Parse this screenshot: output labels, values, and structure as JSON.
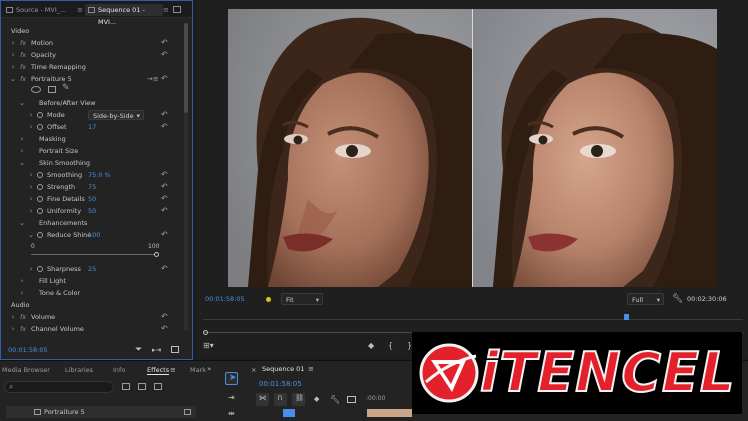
{
  "effect_controls": {
    "tabs": [
      {
        "label": "Source - MVI_..."
      },
      {
        "label": "Sequence 01 - MVI..."
      }
    ],
    "rows": [
      {
        "type": "section",
        "label": "Video"
      },
      {
        "type": "fx",
        "label": "Motion"
      },
      {
        "type": "fx",
        "label": "Opacity"
      },
      {
        "type": "fx",
        "label": "Time Remapping"
      },
      {
        "type": "fx",
        "label": "Portraiture 5"
      },
      {
        "type": "group",
        "label": "Before/After View"
      },
      {
        "type": "param",
        "label": "Mode",
        "value": "Side-by-Side"
      },
      {
        "type": "param",
        "label": "Offset",
        "value": "17"
      },
      {
        "type": "group",
        "label": "Masking"
      },
      {
        "type": "group",
        "label": "Portrait Size"
      },
      {
        "type": "group",
        "label": "Skin Smoothing"
      },
      {
        "type": "param",
        "label": "Smoothing",
        "value": "75.0 %"
      },
      {
        "type": "param",
        "label": "Strength",
        "value": "75"
      },
      {
        "type": "param",
        "label": "Fine Details",
        "value": "50"
      },
      {
        "type": "param",
        "label": "Uniformity",
        "value": "50"
      },
      {
        "type": "group",
        "label": "Enhancements"
      },
      {
        "type": "param",
        "label": "Reduce Shine",
        "value": "100"
      },
      {
        "type": "param",
        "label": "Sharpness",
        "value": "25"
      },
      {
        "type": "group",
        "label": "Fill Light"
      },
      {
        "type": "group",
        "label": "Tone & Color"
      },
      {
        "type": "section",
        "label": "Audio"
      },
      {
        "type": "fx",
        "label": "Volume"
      },
      {
        "type": "fx",
        "label": "Channel Volume"
      }
    ],
    "slider": {
      "min": "0",
      "max": "100",
      "value_fraction": 1.0
    },
    "timecode": "00:01:58:05"
  },
  "monitor": {
    "timecode_left": "00:01:58:05",
    "fit_label": "Fit",
    "full_label": "Full",
    "timecode_right": "00:02:30:06",
    "playhead_fraction": 0.78
  },
  "bottom_panel": {
    "tabs": [
      "Media Browser",
      "Libraries",
      "Info",
      "Effects",
      "Mark"
    ],
    "active_tab": "Effects",
    "effects_item": "Portraiture 5",
    "sequence_tab": "Sequence 01",
    "sequence_timecode": "00:01:58:05",
    "ruler_label": ":00:00"
  },
  "logo": {
    "text": "iTENCEL"
  },
  "colors": {
    "accent_blue": "#4a8fe6",
    "logo_red": "#e4202a",
    "marker_yellow": "#e0c01a"
  }
}
